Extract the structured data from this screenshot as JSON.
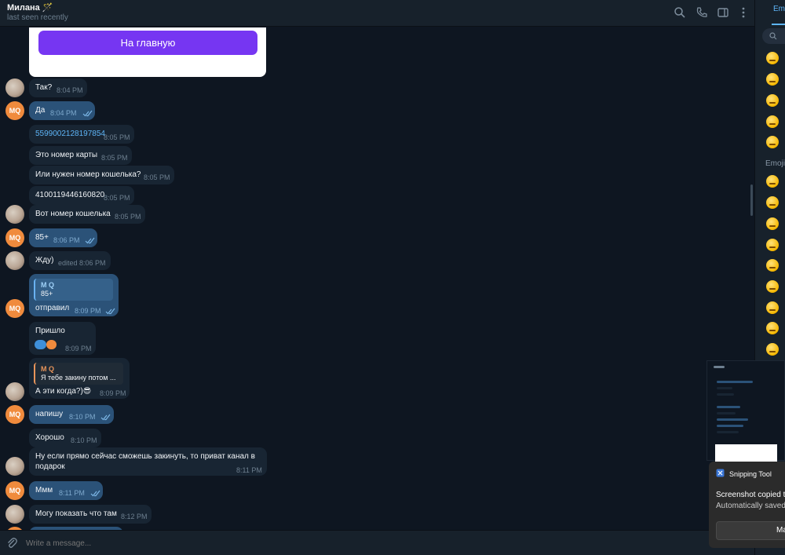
{
  "header": {
    "contact_name": "Милана 🪄",
    "status": "last seen recently",
    "icons": [
      "search-icon",
      "phone-icon",
      "sidebar-toggle-icon",
      "more-vertical-icon"
    ]
  },
  "card": {
    "button_label": "На главную"
  },
  "messages": [
    {
      "text": "Так?",
      "time": "8:04 PM"
    },
    {
      "text": "Да",
      "time": "8:04 PM"
    },
    {
      "text": "5599002128197854",
      "time": "8:05 PM"
    },
    {
      "text": "Это номер карты",
      "time": "8:05 PM"
    },
    {
      "text": "Или нужен номер кошелька?",
      "time": "8:05 PM"
    },
    {
      "text": "4100119446160820",
      "time": "8:05 PM"
    },
    {
      "text": "Вот номер кошелька",
      "time": "8:05 PM"
    },
    {
      "text": "85+",
      "time": "8:06 PM"
    },
    {
      "text": "Жду)",
      "time": "edited 8:06 PM"
    },
    {
      "quote_name": "M Q",
      "quote_text": "85+",
      "text": "отправил",
      "time": "8:09 PM"
    },
    {
      "text": "Пришло",
      "time": "8:09 PM"
    },
    {
      "quote_name": "M Q",
      "quote_text": "Я тебе закину потом ...",
      "text": "А эти когда?)😎",
      "time": "8:09 PM"
    },
    {
      "text": "напишу",
      "time": "8:10 PM"
    },
    {
      "text": "Хорошо",
      "time": "8:10 PM"
    },
    {
      "text": "Ну если прямо сейчас сможешь закинуть, то приват канал в",
      "text2": "подарок",
      "time": "8:11 PM"
    },
    {
      "text": "Ммм",
      "time": "8:11 PM"
    },
    {
      "text": "Могу показать что там",
      "time": "8:12 PM"
    }
  ],
  "avatar_initials": "MQ",
  "composer": {
    "placeholder": "Write a message..."
  },
  "panel": {
    "tab_label": "Emoji",
    "category_label": "Emoji"
  },
  "notification": {
    "app_name": "Snipping Tool",
    "title": "Screenshot copied to clipboard",
    "subtitle": "Automatically saved to screenshots folder",
    "button_label": "Mark up and share"
  },
  "colors": {
    "accent": "#5eb5f7",
    "outgoing": "#2b5278",
    "incoming": "#182533",
    "button": "#7636f2",
    "avatar_mq": "#f08b3d"
  }
}
